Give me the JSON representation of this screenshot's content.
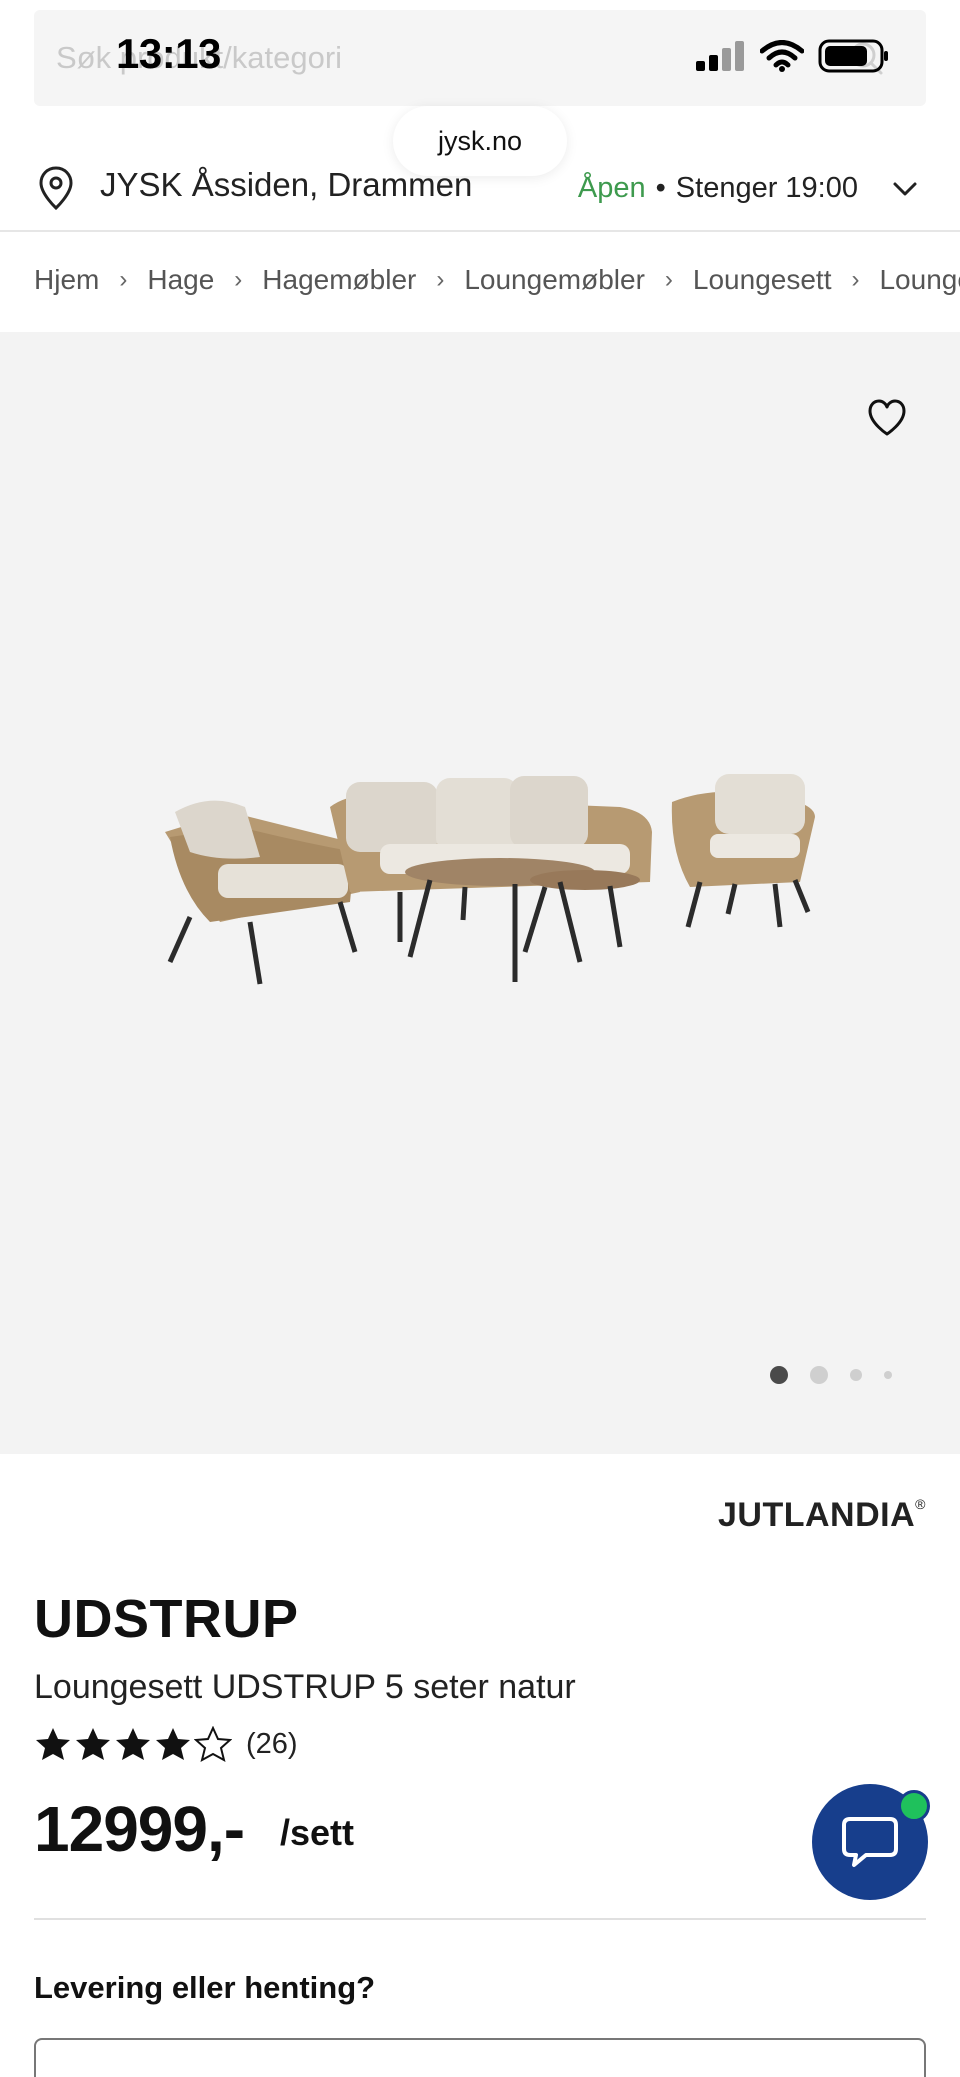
{
  "search": {
    "placeholder": "Søk produkt/kategori"
  },
  "status_bar": {
    "time": "13:13"
  },
  "browser": {
    "url": "jysk.no"
  },
  "store": {
    "name": "JYSK Åssiden, Drammen",
    "open_label": "Åpen",
    "separator": "•",
    "closing_label": "Stenger 19:00"
  },
  "breadcrumb": [
    "Hjem",
    "Hage",
    "Hagemøbler",
    "Loungemøbler",
    "Loungesett",
    "Loungesett"
  ],
  "gallery": {
    "current": 1,
    "total": 4
  },
  "product": {
    "brand": "JUTLANDIA",
    "brand_mark": "®",
    "name": "UDSTRUP",
    "subtitle": "Loungesett UDSTRUP 5 seter natur",
    "rating": 4,
    "rating_max": 5,
    "review_count": "(26)",
    "price": "12999,-",
    "price_unit": "/sett"
  },
  "delivery": {
    "title": "Levering eller henting?"
  },
  "colors": {
    "accent_open": "#3e9a4e",
    "chat_button": "#173e8c",
    "chat_badge": "#1fc15c"
  },
  "icons": [
    "search-icon",
    "location-pin-icon",
    "chevron-down-icon",
    "chevron-right-icon",
    "heart-icon",
    "star-icon",
    "chat-icon"
  ]
}
